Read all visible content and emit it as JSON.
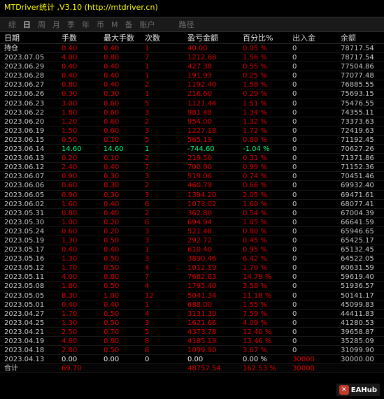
{
  "window": {
    "title": "MTDriver统计 ,V3.10 (http://mtdriver.cn)"
  },
  "tabs": [
    "综",
    "日",
    "周",
    "月",
    "季",
    "年",
    "币",
    "M",
    "备",
    "账户",
    "路径"
  ],
  "active_tab": "日",
  "columns": [
    "日期",
    "手数",
    "最大手数",
    "次数",
    "盈亏金额",
    "百分比%",
    "出入金",
    "余额"
  ],
  "rows": [
    {
      "date": "持仓",
      "lots": "0.40",
      "max": "0.40",
      "cnt": "1",
      "pnl": "40.00",
      "pct": "0.05 %",
      "io": "0",
      "bal": "78717.54",
      "sign": "pos"
    },
    {
      "date": "2023.07.05",
      "lots": "4.00",
      "max": "0.80",
      "cnt": "7",
      "pnl": "1212.68",
      "pct": "1.56 %",
      "io": "0",
      "bal": "78717.54",
      "sign": "pos"
    },
    {
      "date": "2023.06.29",
      "lots": "0.40",
      "max": "0.40",
      "cnt": "1",
      "pnl": "427.38",
      "pct": "0.55 %",
      "io": "0",
      "bal": "77504.86",
      "sign": "pos"
    },
    {
      "date": "2023.06.28",
      "lots": "0.40",
      "max": "0.40",
      "cnt": "1",
      "pnl": "191.93",
      "pct": "0.25 %",
      "io": "0",
      "bal": "77077.48",
      "sign": "pos"
    },
    {
      "date": "2023.06.27",
      "lots": "0.80",
      "max": "0.40",
      "cnt": "2",
      "pnl": "1192.40",
      "pct": "1.58 %",
      "io": "0",
      "bal": "76885.55",
      "sign": "pos"
    },
    {
      "date": "2023.06.26",
      "lots": "0.30",
      "max": "0.30",
      "cnt": "1",
      "pnl": "216.60",
      "pct": "0.29 %",
      "io": "0",
      "bal": "75693.15",
      "sign": "pos"
    },
    {
      "date": "2023.06.23",
      "lots": "3.00",
      "max": "0.60",
      "cnt": "5",
      "pnl": "1121.44",
      "pct": "1.51 %",
      "io": "0",
      "bal": "75476.55",
      "sign": "pos"
    },
    {
      "date": "2023.06.22",
      "lots": "1.80",
      "max": "0.60",
      "cnt": "3",
      "pnl": "981.48",
      "pct": "1.34 %",
      "io": "0",
      "bal": "74355.11",
      "sign": "pos"
    },
    {
      "date": "2023.06.20",
      "lots": "1.20",
      "max": "0.60",
      "cnt": "2",
      "pnl": "954.00",
      "pct": "1.32 %",
      "io": "0",
      "bal": "73373.63",
      "sign": "pos"
    },
    {
      "date": "2023.06.19",
      "lots": "1.50",
      "max": "0.60",
      "cnt": "3",
      "pnl": "1227.18",
      "pct": "1.72 %",
      "io": "0",
      "bal": "72419.63",
      "sign": "pos"
    },
    {
      "date": "2023.06.15",
      "lots": "0.50",
      "max": "0.10",
      "cnt": "5",
      "pnl": "565.19",
      "pct": "0.80 %",
      "io": "0",
      "bal": "71192.45",
      "sign": "pos"
    },
    {
      "date": "2023.06.14",
      "lots": "14.60",
      "max": "14.60",
      "cnt": "1",
      "pnl": "-744.60",
      "pct": "-1.04 %",
      "io": "0",
      "bal": "70627.26",
      "sign": "neg"
    },
    {
      "date": "2023.06.13",
      "lots": "0.20",
      "max": "0.10",
      "cnt": "2",
      "pnl": "219.50",
      "pct": "0.31 %",
      "io": "0",
      "bal": "71371.86",
      "sign": "pos"
    },
    {
      "date": "2023.06.12",
      "lots": "2.40",
      "max": "0.40",
      "cnt": "7",
      "pnl": "700.90",
      "pct": "0.99 %",
      "io": "0",
      "bal": "71152.36",
      "sign": "pos"
    },
    {
      "date": "2023.06.07",
      "lots": "0.90",
      "max": "0.30",
      "cnt": "3",
      "pnl": "519.06",
      "pct": "0.74 %",
      "io": "0",
      "bal": "70451.46",
      "sign": "pos"
    },
    {
      "date": "2023.06.06",
      "lots": "0.60",
      "max": "0.30",
      "cnt": "2",
      "pnl": "460.79",
      "pct": "0.66 %",
      "io": "0",
      "bal": "69932.40",
      "sign": "pos"
    },
    {
      "date": "2023.06.05",
      "lots": "0.90",
      "max": "0.30",
      "cnt": "3",
      "pnl": "1394.20",
      "pct": "2.05 %",
      "io": "0",
      "bal": "69471.61",
      "sign": "pos"
    },
    {
      "date": "2023.06.02",
      "lots": "1.60",
      "max": "0.40",
      "cnt": "6",
      "pnl": "1073.02",
      "pct": "1.60 %",
      "io": "0",
      "bal": "68077.41",
      "sign": "pos"
    },
    {
      "date": "2023.05.31",
      "lots": "0.80",
      "max": "0.40",
      "cnt": "2",
      "pnl": "362.80",
      "pct": "0.54 %",
      "io": "0",
      "bal": "67004.39",
      "sign": "pos"
    },
    {
      "date": "2023.05.30",
      "lots": "1.00",
      "max": "0.20",
      "cnt": "6",
      "pnl": "694.94",
      "pct": "1.05 %",
      "io": "0",
      "bal": "66641.59",
      "sign": "pos"
    },
    {
      "date": "2023.05.24",
      "lots": "0.60",
      "max": "0.20",
      "cnt": "3",
      "pnl": "521.48",
      "pct": "0.80 %",
      "io": "0",
      "bal": "65946.65",
      "sign": "pos"
    },
    {
      "date": "2023.05.19",
      "lots": "1.30",
      "max": "0.50",
      "cnt": "3",
      "pnl": "292.72",
      "pct": "0.45 %",
      "io": "0",
      "bal": "65425.17",
      "sign": "pos"
    },
    {
      "date": "2023.05.17",
      "lots": "0.40",
      "max": "0.40",
      "cnt": "1",
      "pnl": "610.40",
      "pct": "0.95 %",
      "io": "0",
      "bal": "65132.45",
      "sign": "pos"
    },
    {
      "date": "2023.05.16",
      "lots": "1.30",
      "max": "0.50",
      "cnt": "3",
      "pnl": "3890.46",
      "pct": "6.42 %",
      "io": "0",
      "bal": "64522.05",
      "sign": "pos"
    },
    {
      "date": "2023.05.12",
      "lots": "1.70",
      "max": "0.50",
      "cnt": "4",
      "pnl": "1012.19",
      "pct": "1.70 %",
      "io": "0",
      "bal": "60631.59",
      "sign": "pos"
    },
    {
      "date": "2023.05.11",
      "lots": "4.00",
      "max": "0.80",
      "cnt": "7",
      "pnl": "7682.83",
      "pct": "14.79 %",
      "io": "0",
      "bal": "59619.40",
      "sign": "pos"
    },
    {
      "date": "2023.05.08",
      "lots": "1.80",
      "max": "0.50",
      "cnt": "4",
      "pnl": "1795.40",
      "pct": "3.58 %",
      "io": "0",
      "bal": "51936.57",
      "sign": "pos"
    },
    {
      "date": "2023.05.05",
      "lots": "8.30",
      "max": "1.00",
      "cnt": "12",
      "pnl": "5041.34",
      "pct": "11.18 %",
      "io": "0",
      "bal": "50141.17",
      "sign": "pos"
    },
    {
      "date": "2023.05.01",
      "lots": "0.40",
      "max": "0.40",
      "cnt": "1",
      "pnl": "688.00",
      "pct": "1.55 %",
      "io": "0",
      "bal": "45099.83",
      "sign": "pos"
    },
    {
      "date": "2023.04.27",
      "lots": "1.70",
      "max": "0.50",
      "cnt": "4",
      "pnl": "3131.30",
      "pct": "7.59 %",
      "io": "0",
      "bal": "44411.83",
      "sign": "pos"
    },
    {
      "date": "2023.04.25",
      "lots": "1.30",
      "max": "0.50",
      "cnt": "3",
      "pnl": "1621.66",
      "pct": "4.09 %",
      "io": "0",
      "bal": "41280.53",
      "sign": "pos"
    },
    {
      "date": "2023.04.21",
      "lots": "2.50",
      "max": "0.70",
      "cnt": "5",
      "pnl": "4373.78",
      "pct": "12.40 %",
      "io": "0",
      "bal": "39658.87",
      "sign": "pos"
    },
    {
      "date": "2023.04.19",
      "lots": "4.80",
      "max": "0.80",
      "cnt": "8",
      "pnl": "4185.19",
      "pct": "13.46 %",
      "io": "0",
      "bal": "35285.09",
      "sign": "pos"
    },
    {
      "date": "2023.04.18",
      "lots": "2.80",
      "max": "0.50",
      "cnt": "6",
      "pnl": "1099.90",
      "pct": "3.67 %",
      "io": "0",
      "bal": "31099.90",
      "sign": "pos"
    },
    {
      "date": "2023.04.13",
      "lots": "0.00",
      "max": "0.00",
      "cnt": "0",
      "pnl": "0.00",
      "pct": "0.00 %",
      "io": "30000",
      "bal": "30000.00",
      "sign": "zero"
    }
  ],
  "total": {
    "label": "合计",
    "lots": "69.70",
    "max": "",
    "cnt": "",
    "pnl": "48757.54",
    "pct": "162.53 %",
    "io": "30000",
    "bal": ""
  },
  "watermark": {
    "text": "EAHub"
  },
  "colors": {
    "positive": "#e00000",
    "negative": "#00ff7f",
    "io": "#e00000",
    "title": "#ffff00"
  }
}
